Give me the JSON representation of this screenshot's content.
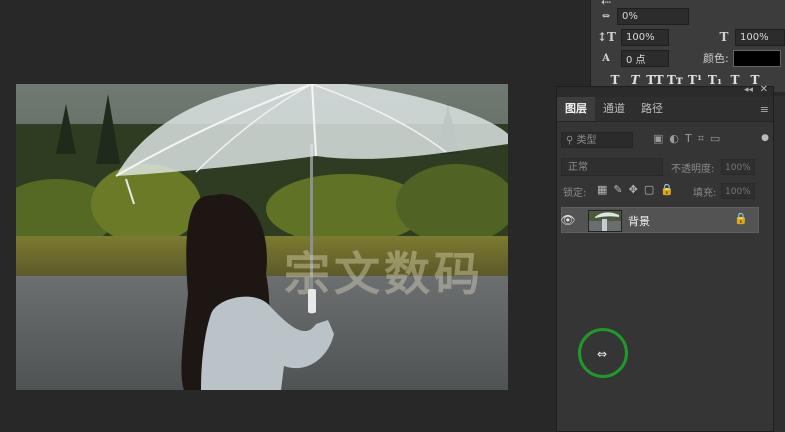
{
  "canvas": {
    "watermark_text": "宗文数码"
  },
  "character_panel": {
    "tracking_value": "0%",
    "vertical_scale": "100%",
    "horizontal_scale": "100%",
    "baseline_shift": "0 点",
    "color_label": "颜色:",
    "color_value": "#000000",
    "type_style_buttons": [
      "T",
      "T",
      "TT",
      "Tт",
      "T¹",
      "T₁",
      "T",
      "T"
    ]
  },
  "layers_panel": {
    "tabs": [
      {
        "label": "图层",
        "active": true
      },
      {
        "label": "通道",
        "active": false
      },
      {
        "label": "路径",
        "active": false
      }
    ],
    "filter_placeholder": "类型",
    "blend_mode": "正常",
    "opacity_label": "不透明度:",
    "opacity_value": "100%",
    "lock_label": "锁定:",
    "fill_label": "填充:",
    "fill_value": "100%",
    "layers": [
      {
        "name": "背景",
        "visible": true,
        "locked": true
      }
    ]
  },
  "colors": {
    "app_bg": "#282828",
    "panel_bg": "#353535",
    "selected_layer": "#535353",
    "cursor_ring": "#1f9a2a"
  }
}
